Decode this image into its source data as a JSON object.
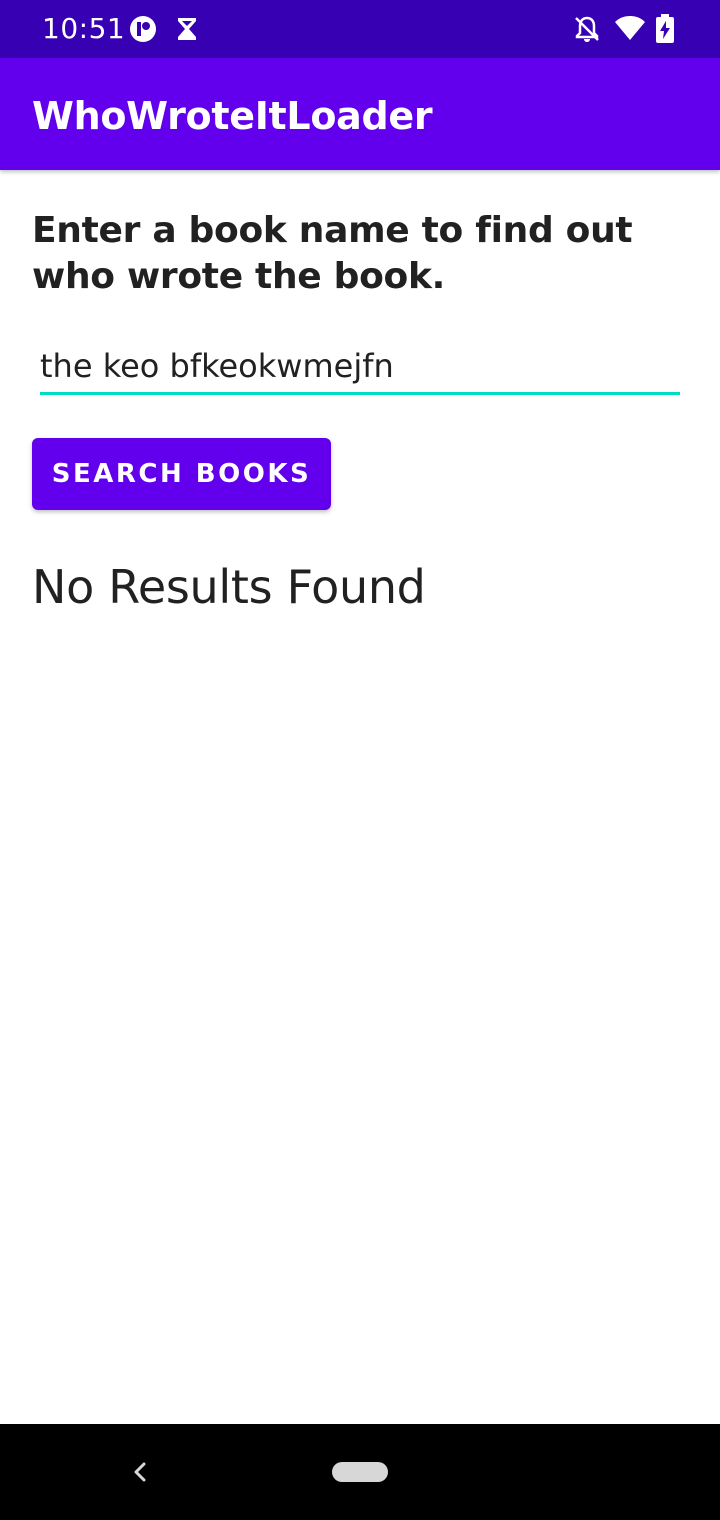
{
  "status_bar": {
    "time": "10:51",
    "icons": [
      "app-notification-icon",
      "hourglass-icon",
      "do-not-disturb-bell-icon",
      "wifi-icon",
      "battery-charging-icon"
    ]
  },
  "app_bar": {
    "title": "WhoWroteItLoader"
  },
  "main": {
    "instructions": "Enter a book name to find out who wrote the book.",
    "book_input_value": "the keo bfkeokwmejfn",
    "search_button_label": "SEARCH BOOKS",
    "result_text": "No Results Found"
  },
  "colors": {
    "status_bar": "#3700b3",
    "primary": "#6200ee",
    "accent": "#03dac5"
  },
  "nav_bar": {
    "icons": [
      "back-icon",
      "home-pill-icon"
    ]
  }
}
